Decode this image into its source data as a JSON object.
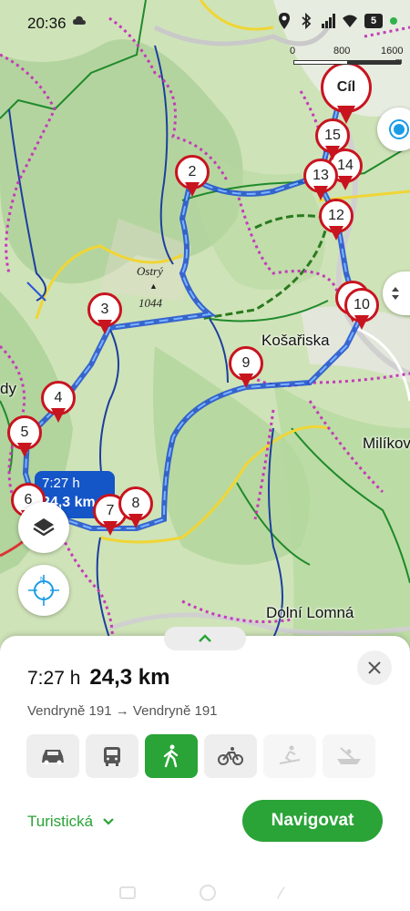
{
  "status_bar": {
    "time": "20:36",
    "battery": "5"
  },
  "scale_bar": {
    "labels": [
      "0",
      "800",
      "1600"
    ],
    "unit": "m"
  },
  "map": {
    "place_labels": [
      "Košařiska",
      "Milíkov",
      "Dolní Lomná",
      "dy"
    ],
    "peak": {
      "name": "Ostrý",
      "elevation": "1044"
    },
    "markers": [
      "2",
      "3",
      "4",
      "5",
      "6",
      "7",
      "8",
      "9",
      "10",
      "12",
      "13",
      "14",
      "15",
      "Cíl",
      "1"
    ],
    "route_badge": {
      "time": "7:27 h",
      "distance": "24,3 km"
    }
  },
  "sheet": {
    "time": "7:27 h",
    "distance": "24,3 km",
    "from": "Vendryně 191",
    "arrow": "→",
    "to": "Vendryně 191",
    "modes": [
      "car",
      "bus",
      "walk",
      "bike",
      "ski",
      "boat"
    ],
    "active_mode": "walk",
    "route_type": "Turistická",
    "navigate_label": "Navigovat"
  },
  "colors": {
    "accent": "#2aa337",
    "route": "#1455c8",
    "marker": "#c8141f"
  }
}
